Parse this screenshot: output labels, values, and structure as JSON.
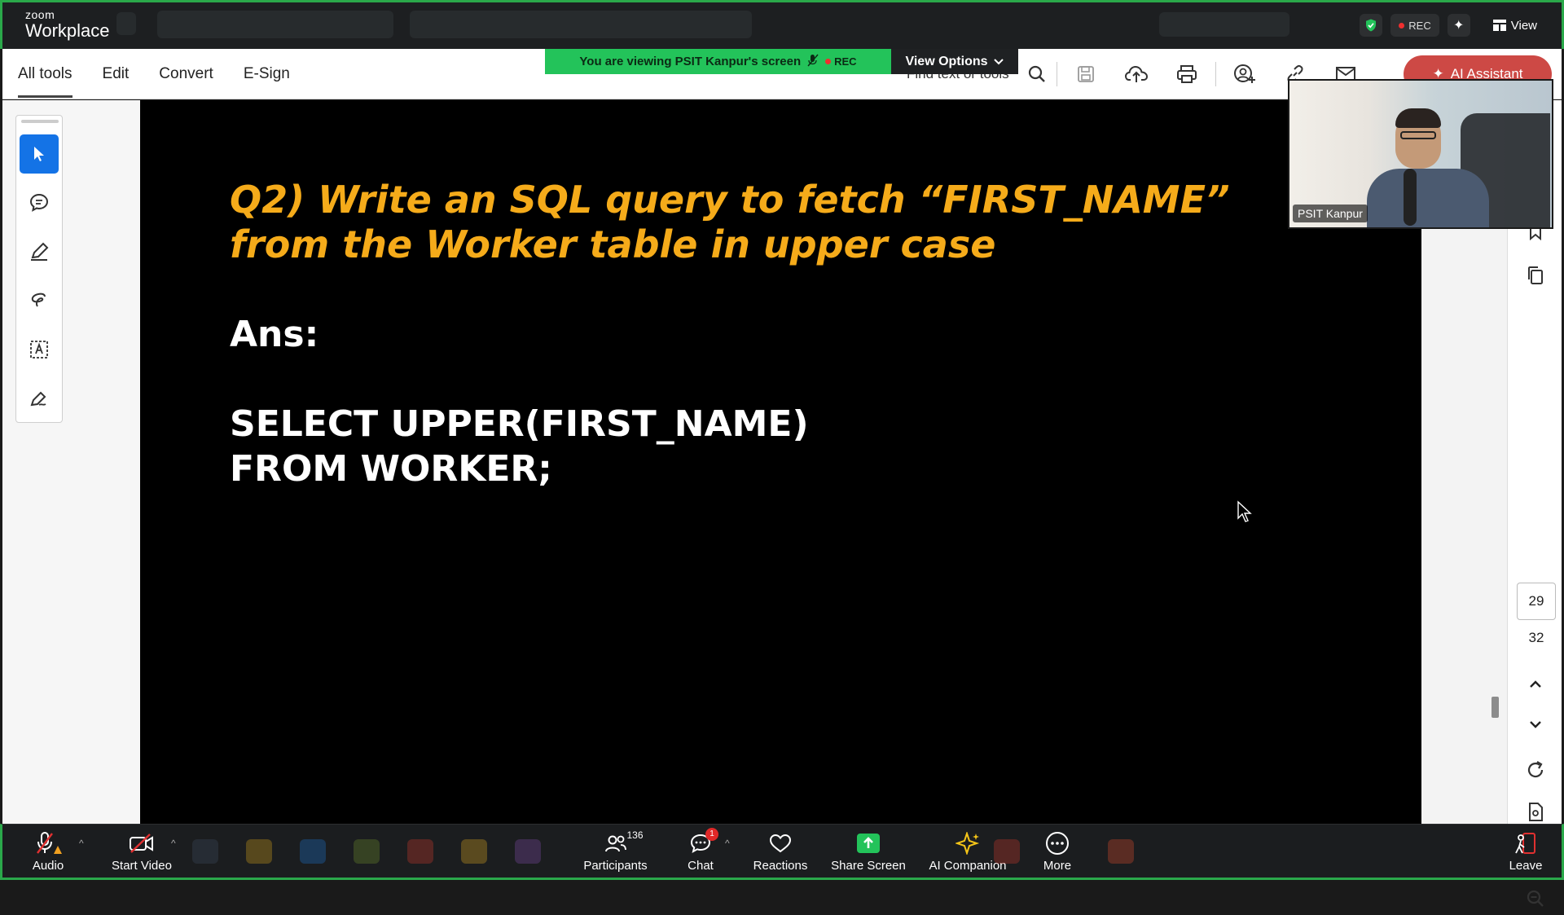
{
  "zoom_top": {
    "logo_small": "zoom",
    "logo_big": "Workplace",
    "rec_label": "REC",
    "view_label": "View"
  },
  "acrobat": {
    "tabs": [
      "All tools",
      "Edit",
      "Convert",
      "E-Sign"
    ],
    "active_tab": "All tools",
    "find_placeholder": "Find text or tools",
    "ai_assistant": "AI Assistant"
  },
  "banner": {
    "viewing_text": "You are viewing  PSIT Kanpur's screen",
    "rec_label": "REC",
    "view_options": "View Options"
  },
  "document": {
    "question": "Q2) Write an SQL query to fetch “FIRST_NAME”\nfrom the Worker table in upper case",
    "answer_label": "Ans:",
    "code_line1": "SELECT UPPER(FIRST_NAME)",
    "code_line2": "FROM WORKER;",
    "question_color": "#f5ab1a"
  },
  "page_nav": {
    "current_page": "29",
    "total_pages": "32"
  },
  "video": {
    "participant_name": "PSIT Kanpur"
  },
  "zoom_bottom": {
    "audio": "Audio",
    "start_video": "Start Video",
    "participants": "Participants",
    "participants_count": "136",
    "chat": "Chat",
    "chat_badge": "1",
    "reactions": "Reactions",
    "share_screen": "Share Screen",
    "ai_companion": "AI Companion",
    "more": "More",
    "leave": "Leave"
  },
  "colors": {
    "zoom_green": "#2aa84a",
    "banner_green": "#23c35a",
    "acrobat_blue": "#1473e6",
    "share_green": "#23c35a"
  }
}
